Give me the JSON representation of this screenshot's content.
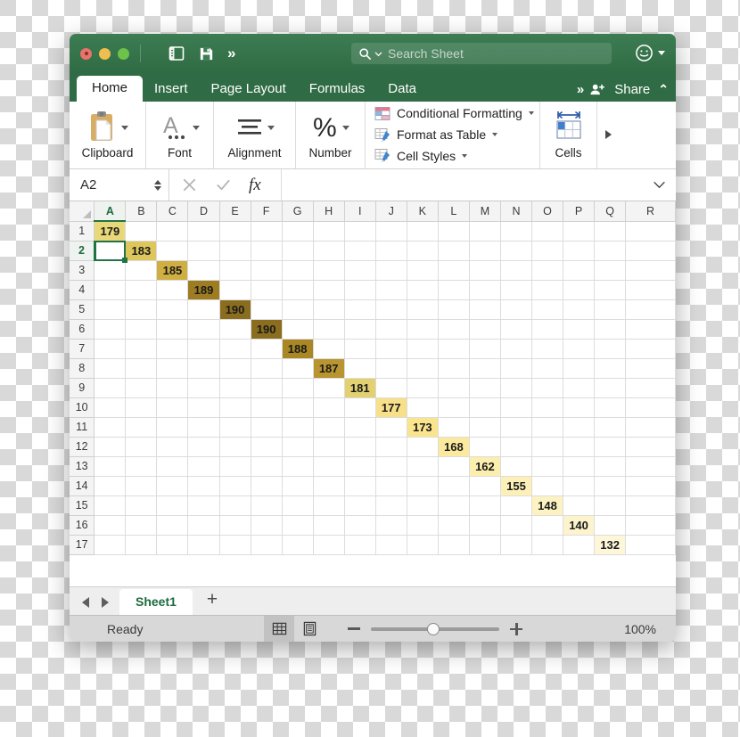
{
  "window": {
    "traffic_lights": [
      "close",
      "minimize",
      "maximize"
    ],
    "toolbar_icons": [
      "sidebar-icon",
      "save-icon",
      "overflow-chevrons-icon"
    ]
  },
  "search": {
    "placeholder": "Search Sheet",
    "icon": "search-icon",
    "account_icon": "smiley-face-icon"
  },
  "tabs": [
    {
      "label": "Home",
      "active": true
    },
    {
      "label": "Insert",
      "active": false
    },
    {
      "label": "Page Layout",
      "active": false
    },
    {
      "label": "Formulas",
      "active": false
    },
    {
      "label": "Data",
      "active": false
    }
  ],
  "tab_overflow": "»",
  "share": {
    "label": "Share",
    "icon": "person-add-icon"
  },
  "ribbon_collapse": "⌃",
  "ribbon": {
    "groups": [
      {
        "label": "Clipboard",
        "icon": "clipboard-icon",
        "has_caret": true
      },
      {
        "label": "Font",
        "icon": "font-a-icon",
        "has_caret": true
      },
      {
        "label": "Alignment",
        "icon": "alignment-lines-icon",
        "has_caret": true
      },
      {
        "label": "Number",
        "icon": "percent-icon",
        "has_caret": true
      }
    ],
    "styles": [
      {
        "label": "Conditional Formatting",
        "icon": "conditional-formatting-icon"
      },
      {
        "label": "Format as Table",
        "icon": "format-as-table-icon"
      },
      {
        "label": "Cell Styles",
        "icon": "cell-styles-icon"
      }
    ],
    "cells": {
      "label": "Cells",
      "icon": "cells-grid-icon"
    },
    "more_icon": "ribbon-more-arrow-icon"
  },
  "formula_bar": {
    "name_box": "A2",
    "cancel_icon": "cancel-x-icon",
    "confirm_icon": "confirm-check-icon",
    "fx_label": "fx",
    "formula_value": "",
    "expand_icon": "chevron-down-icon"
  },
  "grid": {
    "columns": [
      "A",
      "B",
      "C",
      "D",
      "E",
      "F",
      "G",
      "H",
      "I",
      "J",
      "K",
      "L",
      "M",
      "N",
      "O",
      "P",
      "Q",
      "R"
    ],
    "active_column": "A",
    "rows": [
      1,
      2,
      3,
      4,
      5,
      6,
      7,
      8,
      9,
      10,
      11,
      12,
      13,
      14,
      15,
      16,
      17
    ],
    "active_row": 2,
    "selected_cell": "A2"
  },
  "chart_data": {
    "type": "table",
    "title": "",
    "description": "Diagonal series of values, one per row, in successive columns A–Q; cell fill darkens as value increases (conditional color scale).",
    "columns": [
      "A",
      "B",
      "C",
      "D",
      "E",
      "F",
      "G",
      "H",
      "I",
      "J",
      "K",
      "L",
      "M",
      "N",
      "O",
      "P",
      "Q"
    ],
    "rows": [
      1,
      2,
      3,
      4,
      5,
      6,
      7,
      8,
      9,
      10,
      11,
      12,
      13,
      14,
      15,
      16,
      17
    ],
    "cells": [
      {
        "ref": "A1",
        "row": 1,
        "col": "A",
        "value": 179,
        "fill": "#e8d87a"
      },
      {
        "ref": "B2",
        "row": 2,
        "col": "B",
        "value": 183,
        "fill": "#ddc65c"
      },
      {
        "ref": "C3",
        "row": 3,
        "col": "C",
        "value": 185,
        "fill": "#cfae42"
      },
      {
        "ref": "D4",
        "row": 4,
        "col": "D",
        "value": 189,
        "fill": "#9d7c22"
      },
      {
        "ref": "E5",
        "row": 5,
        "col": "E",
        "value": 190,
        "fill": "#8a6d1e"
      },
      {
        "ref": "F6",
        "row": 6,
        "col": "F",
        "value": 190,
        "fill": "#8a6d1e"
      },
      {
        "ref": "G7",
        "row": 7,
        "col": "G",
        "value": 188,
        "fill": "#a88724"
      },
      {
        "ref": "H8",
        "row": 8,
        "col": "H",
        "value": 187,
        "fill": "#b89530"
      },
      {
        "ref": "I9",
        "row": 9,
        "col": "I",
        "value": 181,
        "fill": "#e3d070"
      },
      {
        "ref": "J10",
        "row": 10,
        "col": "J",
        "value": 177,
        "fill": "#f7e089"
      },
      {
        "ref": "K11",
        "row": 11,
        "col": "K",
        "value": 173,
        "fill": "#fae58f"
      },
      {
        "ref": "L12",
        "row": 12,
        "col": "L",
        "value": 168,
        "fill": "#fbe99e"
      },
      {
        "ref": "M13",
        "row": 13,
        "col": "M",
        "value": 162,
        "fill": "#fceeae"
      },
      {
        "ref": "N14",
        "row": 14,
        "col": "N",
        "value": 155,
        "fill": "#fcf0b8"
      },
      {
        "ref": "O15",
        "row": 15,
        "col": "O",
        "value": 148,
        "fill": "#fdf2c2"
      },
      {
        "ref": "P16",
        "row": 16,
        "col": "P",
        "value": 140,
        "fill": "#fdf4ce"
      },
      {
        "ref": "Q17",
        "row": 17,
        "col": "Q",
        "value": 132,
        "fill": "#fdf6d8"
      }
    ],
    "values": [
      179,
      183,
      185,
      189,
      190,
      190,
      188,
      187,
      181,
      177,
      173,
      168,
      162,
      155,
      148,
      140,
      132
    ],
    "value_range": [
      132,
      190
    ]
  },
  "sheet_tabs": {
    "prev_icon": "nav-prev-icon",
    "next_icon": "nav-next-icon",
    "sheets": [
      {
        "label": "Sheet1",
        "active": true
      }
    ],
    "add_label": "+"
  },
  "status_bar": {
    "status": "Ready",
    "view_normal_icon": "normal-view-icon",
    "view_layout_icon": "page-layout-view-icon",
    "zoom_out_icon": "zoom-out-icon",
    "zoom_in_icon": "zoom-in-icon",
    "zoom_level": "100%"
  }
}
